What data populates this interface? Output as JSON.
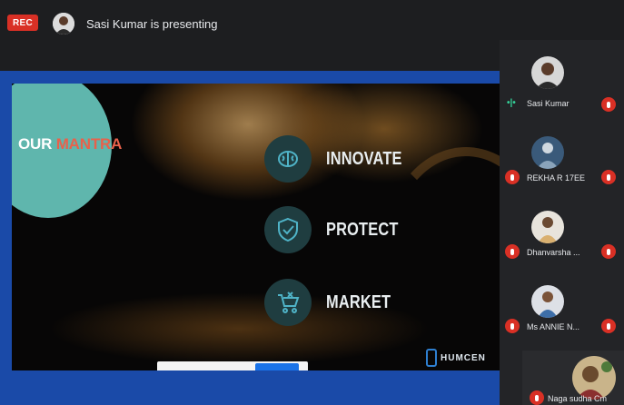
{
  "topbar": {
    "rec_label": "REC",
    "presenting_text": "Sasi Kumar is presenting"
  },
  "slide": {
    "mantra_part1": "OUR ",
    "mantra_part2": "MANTRA",
    "items": [
      {
        "label": "INNOVATE",
        "icon": "brain-icon"
      },
      {
        "label": "PROTECT",
        "icon": "shield-check-icon"
      },
      {
        "label": "MARKET",
        "icon": "cart-icon"
      }
    ],
    "logo_text": "HUMCEN",
    "colors": {
      "mantra_circle": "#5fb6ad",
      "mantra_accent": "#e8614b",
      "icon_bg": "#1f3d40",
      "icon_stroke": "#4fb3c7"
    }
  },
  "participants": [
    {
      "name": "Sasi Kumar",
      "speaking": true
    },
    {
      "name": "REKHA R 17EE",
      "muted": true
    },
    {
      "name": "Dhanvarsha ...",
      "muted": true
    },
    {
      "name": "Ms ANNIE N...",
      "muted": true
    },
    {
      "name": "Naga sudha Cm",
      "muted": true
    }
  ],
  "colors": {
    "background": "#1d1e20",
    "rec": "#d93025",
    "blue_band": "#1a4aa8"
  }
}
